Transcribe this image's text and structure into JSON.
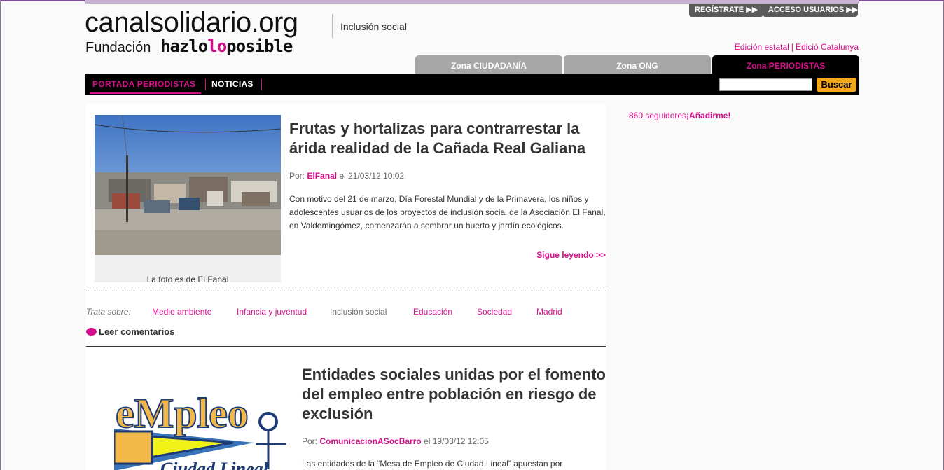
{
  "header": {
    "logo_text": "canalsolidario.org",
    "logo_tagline": "Inclusión social",
    "logo_sub_prefix": "Fundación",
    "logo_sub_brand_1": "hazlo",
    "logo_sub_brand_2": "lo",
    "logo_sub_brand_3": "posible",
    "register_label": "REGÍSTRATE ▶▶",
    "login_label": "ACCESO USUARIOS ▶▶",
    "edition_state": "Edición estatal",
    "edition_catalunya": "Edició Catalunya"
  },
  "zones": [
    {
      "label": "Zona CIUDADANÍA"
    },
    {
      "label": "Zona ONG"
    },
    {
      "label": "Zona PERIODISTAS"
    }
  ],
  "nav": {
    "items": [
      {
        "label": "PORTADA PERIODISTAS"
      },
      {
        "label": "NOTICIAS"
      }
    ],
    "search_placeholder": "",
    "search_button": "Buscar"
  },
  "articles": [
    {
      "title": "Frutas y hortalizas para contrarrestar la árida realidad de la Cañada Real Galiana",
      "by_prefix": "Por:",
      "author": "ElFanal",
      "date": "el 21/03/12 10:02",
      "body": "Con motivo del 21 de marzo, Día Forestal Mundial y de la Primavera, los niños y adolescentes usuarios de los proyectos de inclusión social de la Asociación El Fanal, en Valdemingómez, comenzarán a sembrar un huerto y jardín ecológicos.",
      "read_more": "Sigue leyendo >>",
      "photo_caption": "La foto es de El Fanal"
    },
    {
      "title": "Entidades sociales unidas por el fomento del empleo entre población en riesgo de exclusión",
      "by_prefix": "Por:",
      "author": "ComunicacionASocBarro",
      "date": "el 19/03/12 12:05",
      "body": "Las entidades de la “Mesa de Empleo de Ciudad Lineal” apuestan por",
      "logo_word": "eMpleo",
      "logo_sub": "Ciudad Lineal"
    }
  ],
  "tags": {
    "label": "Trata sobre:",
    "items": [
      {
        "label": "Medio ambiente"
      },
      {
        "label": "Infancia y juventud"
      },
      {
        "label": "Inclusión social"
      },
      {
        "label": "Educación"
      },
      {
        "label": "Sociedad"
      },
      {
        "label": "Madrid"
      }
    ]
  },
  "comments_label": "Leer comentarios",
  "sidebar": {
    "followers": "860 seguidores",
    "join": "¡Añadirme!"
  },
  "colors": {
    "accent": "#d60f8c",
    "zone_inactive": "#a6a6a6",
    "search_button": "#f2a818",
    "nav_bg": "#000000"
  }
}
